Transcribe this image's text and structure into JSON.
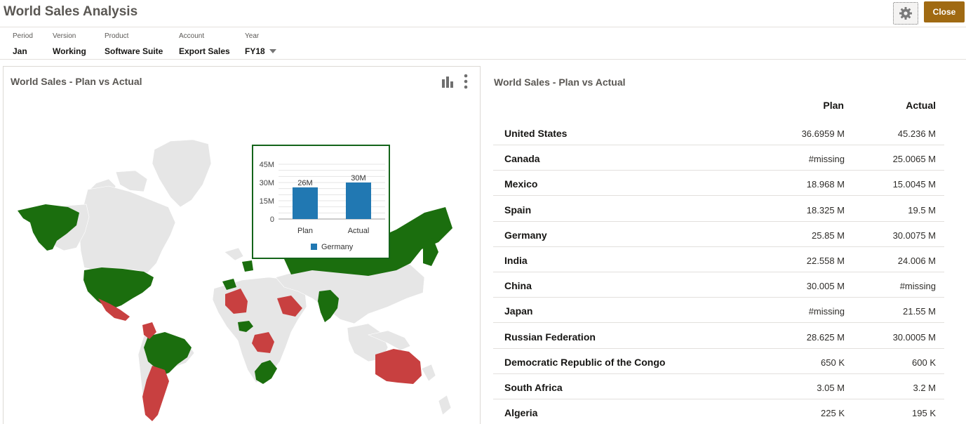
{
  "header": {
    "title": "World Sales Analysis",
    "close_label": "Close",
    "settings_icon": "gear-icon"
  },
  "pov": [
    {
      "label": "Period",
      "value": "Jan"
    },
    {
      "label": "Version",
      "value": "Working"
    },
    {
      "label": "Product",
      "value": "Software Suite"
    },
    {
      "label": "Account",
      "value": "Export Sales"
    },
    {
      "label": "Year",
      "value": "FY18",
      "dropdown": true
    }
  ],
  "map_panel": {
    "title": "World Sales - Plan vs Actual",
    "icons": [
      "bar-chart-icon",
      "more-vertical-icon"
    ],
    "colors": {
      "actual_above_plan": "#1b6e0e",
      "actual_below_plan": "#c84040",
      "no_data": "#e6e6e6"
    },
    "tooltip": {
      "country": "Germany",
      "series_color": "#2178b2",
      "chart_data": {
        "type": "bar",
        "categories": [
          "Plan",
          "Actual"
        ],
        "values": [
          26,
          30
        ],
        "data_labels": [
          "26M",
          "30M"
        ],
        "y_ticks": [
          "0",
          "15M",
          "30M",
          "45M"
        ],
        "ylim": [
          0,
          45
        ],
        "legend": "Germany"
      }
    }
  },
  "grid": {
    "title": "World Sales - Plan vs Actual",
    "columns": [
      "Plan",
      "Actual"
    ],
    "rows": [
      {
        "name": "United States",
        "plan": "36.6959 M",
        "actual": "45.236 M"
      },
      {
        "name": "Canada",
        "plan": "#missing",
        "actual": "25.0065 M"
      },
      {
        "name": "Mexico",
        "plan": "18.968 M",
        "actual": "15.0045 M"
      },
      {
        "name": "Spain",
        "plan": "18.325 M",
        "actual": "19.5 M"
      },
      {
        "name": "Germany",
        "plan": "25.85 M",
        "actual": "30.0075 M"
      },
      {
        "name": "India",
        "plan": "22.558 M",
        "actual": "24.006 M"
      },
      {
        "name": "China",
        "plan": "30.005 M",
        "actual": "#missing"
      },
      {
        "name": "Japan",
        "plan": "#missing",
        "actual": "21.55 M"
      },
      {
        "name": "Russian Federation",
        "plan": "28.625 M",
        "actual": "30.0005 M"
      },
      {
        "name": "Democratic Republic of the Congo",
        "plan": "650 K",
        "actual": "600 K"
      },
      {
        "name": "South Africa",
        "plan": "3.05 M",
        "actual": "3.2 M"
      },
      {
        "name": "Algeria",
        "plan": "225 K",
        "actual": "195 K"
      }
    ]
  }
}
